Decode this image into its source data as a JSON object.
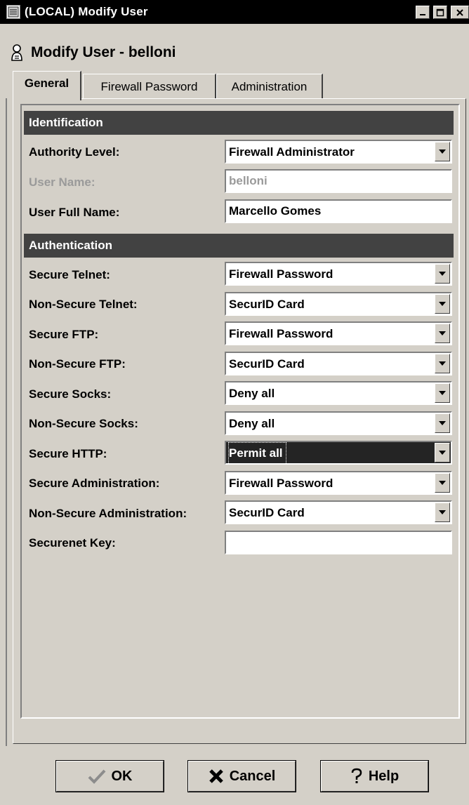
{
  "window": {
    "title": "(LOCAL) Modify User",
    "icon": "app-window-icon",
    "controls": [
      "minimize",
      "maximize",
      "close"
    ]
  },
  "heading": {
    "icon": "user-icon",
    "text": "Modify User - belloni"
  },
  "tabs": [
    {
      "label": "General",
      "active": true
    },
    {
      "label": "Firewall Password",
      "active": false
    },
    {
      "label": "Administration",
      "active": false
    }
  ],
  "sections": {
    "identification": "Identification",
    "authentication": "Authentication"
  },
  "identification": {
    "authority_level": {
      "label": "Authority Level:",
      "value": "Firewall Administrator"
    },
    "user_name": {
      "label": "User Name:",
      "value": "belloni",
      "disabled": true
    },
    "user_full_name": {
      "label": "User Full Name:",
      "value": "Marcello Gomes"
    }
  },
  "authentication": {
    "secure_telnet": {
      "label": "Secure Telnet:",
      "value": "Firewall Password"
    },
    "non_secure_telnet": {
      "label": "Non-Secure Telnet:",
      "value": "SecurID Card"
    },
    "secure_ftp": {
      "label": "Secure FTP:",
      "value": "Firewall Password"
    },
    "non_secure_ftp": {
      "label": "Non-Secure FTP:",
      "value": "SecurID Card"
    },
    "secure_socks": {
      "label": "Secure Socks:",
      "value": "Deny all"
    },
    "non_secure_socks": {
      "label": "Non-Secure Socks:",
      "value": "Deny all"
    },
    "secure_http": {
      "label": "Secure HTTP:",
      "value": "Permit all",
      "selected": true
    },
    "secure_administration": {
      "label": "Secure Administration:",
      "value": "Firewall Password"
    },
    "non_secure_administration": {
      "label": "Non-Secure Administration:",
      "value": "SecurID Card"
    },
    "securenet_key": {
      "label": "Securenet Key:",
      "value": ""
    }
  },
  "buttons": {
    "ok": {
      "label": "OK",
      "icon": "checkmark-icon"
    },
    "cancel": {
      "label": "Cancel",
      "icon": "x-icon"
    },
    "help": {
      "label": "Help",
      "icon": "question-icon"
    }
  },
  "colors": {
    "window_bg": "#d4d0c8",
    "section_bar": "#424242",
    "titlebar": "#000000",
    "disabled_text": "#9a9a9a"
  }
}
